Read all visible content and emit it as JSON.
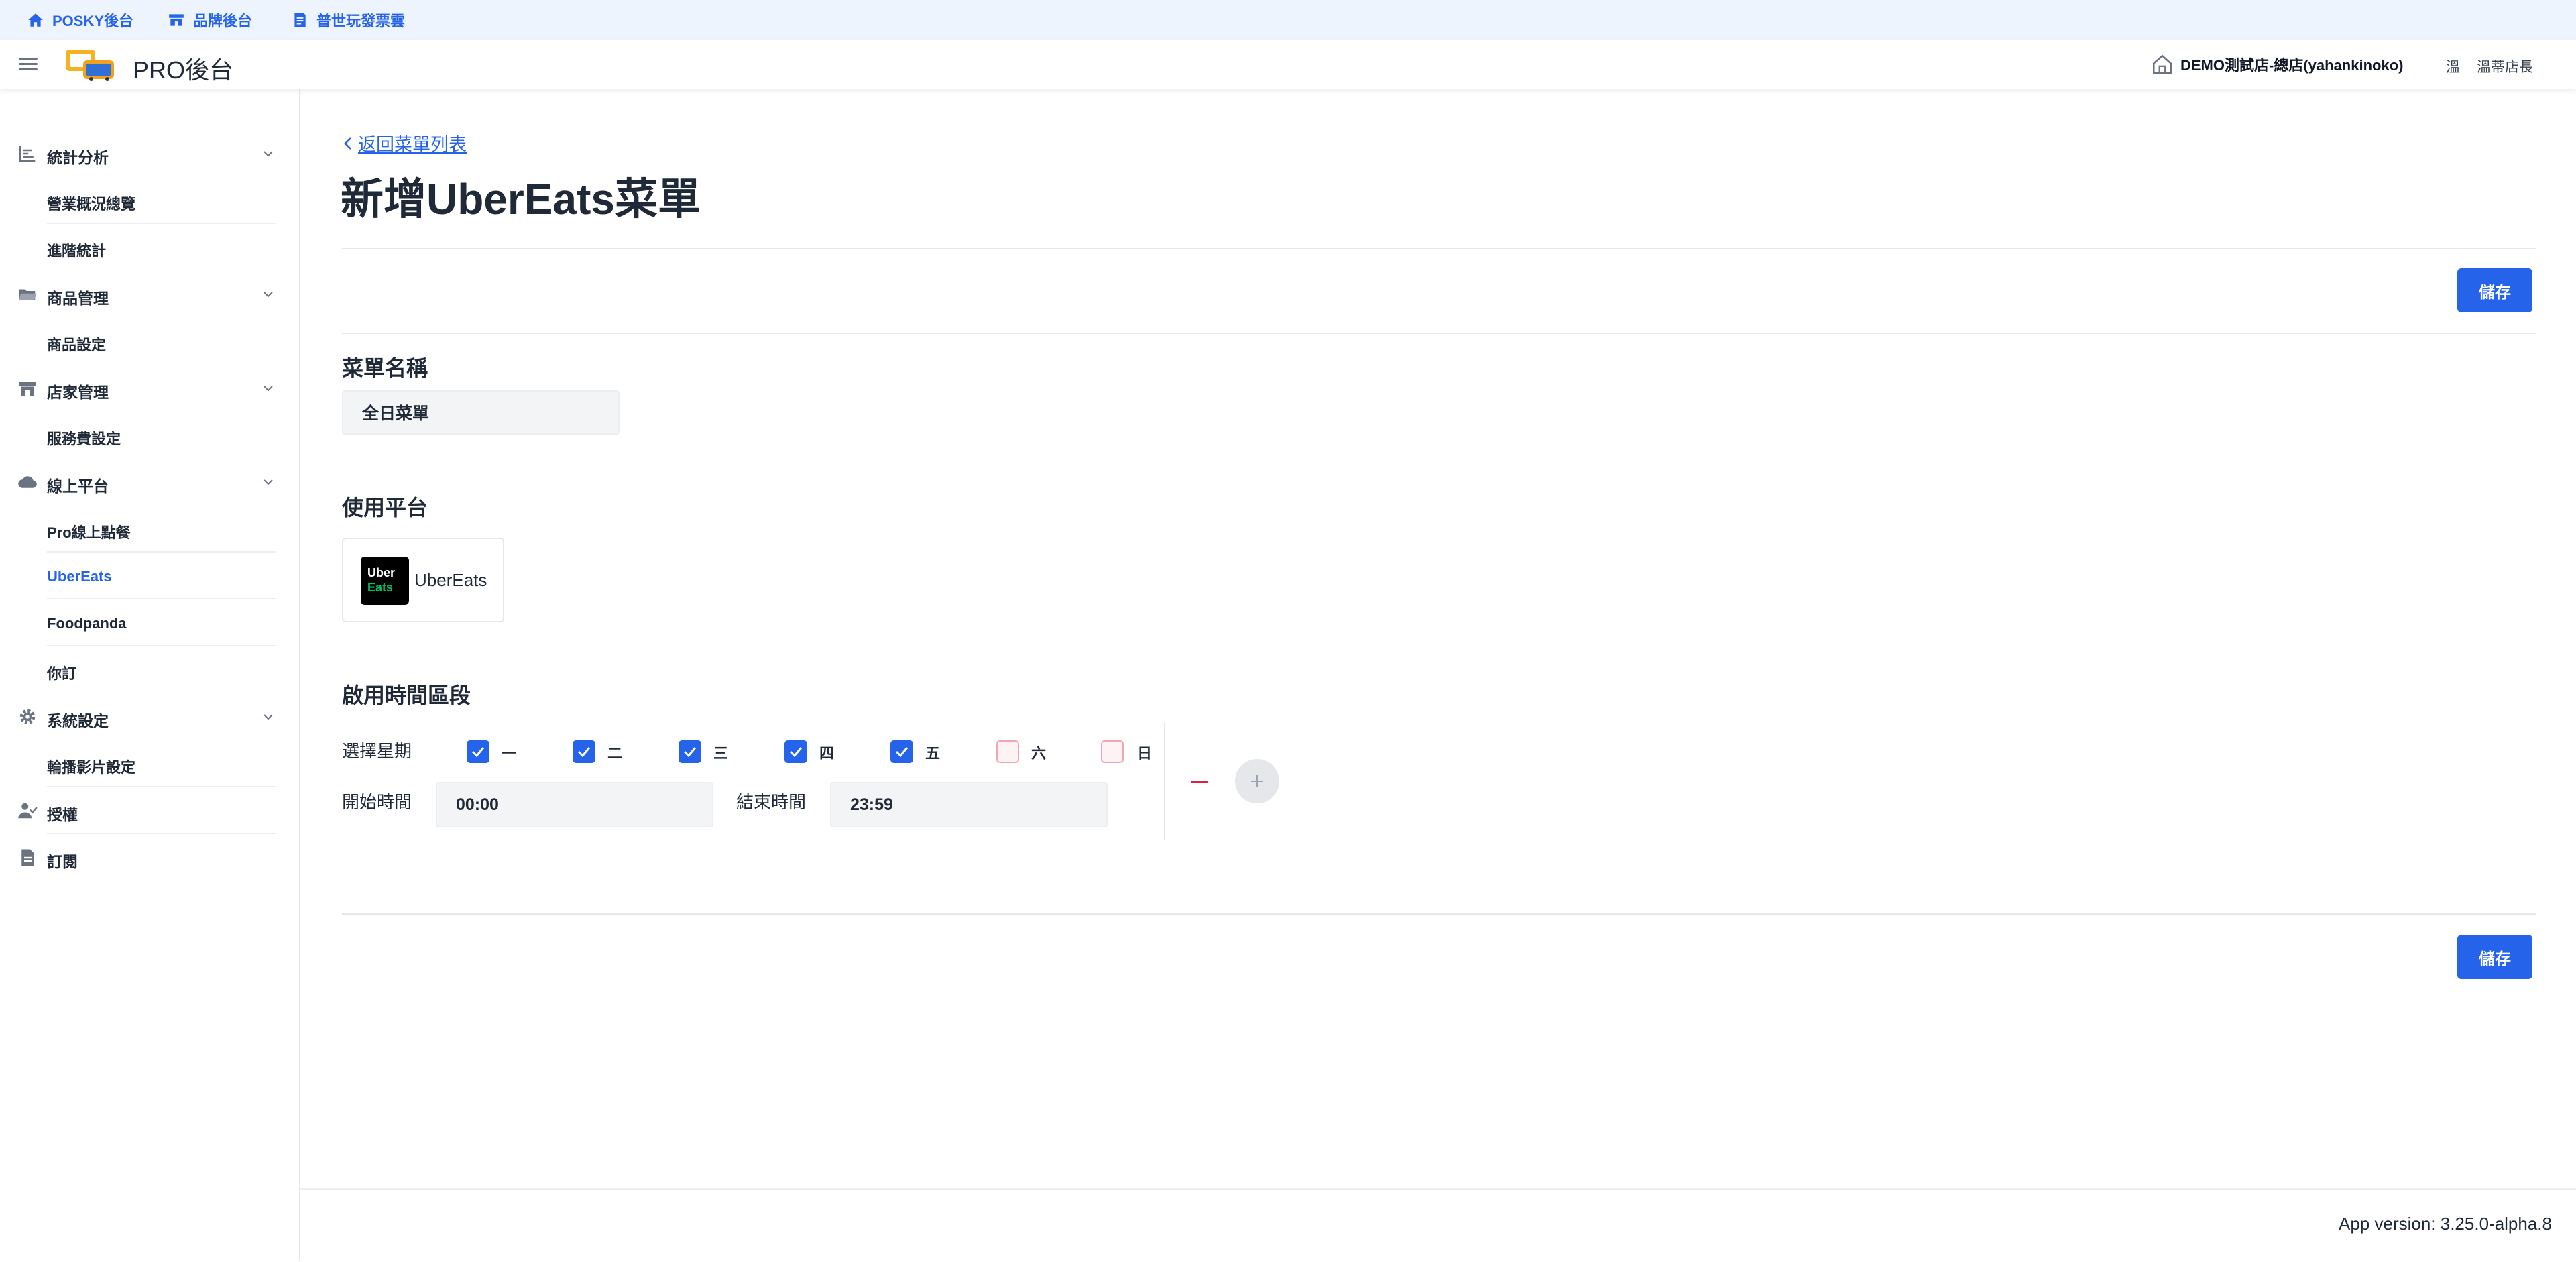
{
  "top_links": [
    {
      "label": "POSKY後台",
      "icon": "home-icon"
    },
    {
      "label": "品牌後台",
      "icon": "brand-store-icon"
    },
    {
      "label": "普世玩發票雲",
      "icon": "invoice-doc-icon"
    }
  ],
  "header": {
    "app_title": "PRO後台",
    "store_name": "DEMO測試店-總店(yahankinoko)",
    "store_icon": "house-icon",
    "user_short": "溫",
    "user_name": "溫蒂店長"
  },
  "sidebar": {
    "groups": [
      {
        "label": "統計分析",
        "icon": "chart-icon",
        "expandable": true,
        "items": [
          "營業概況總覽",
          "進階統計"
        ]
      },
      {
        "label": "商品管理",
        "icon": "folder-icon",
        "expandable": true,
        "items": [
          "商品設定"
        ]
      },
      {
        "label": "店家管理",
        "icon": "storefront-icon",
        "expandable": true,
        "items": [
          "服務費設定"
        ]
      },
      {
        "label": "線上平台",
        "icon": "cloud-icon",
        "expandable": true,
        "items": [
          "Pro線上點餐",
          "UberEats",
          "Foodpanda",
          "你訂"
        ]
      },
      {
        "label": "系統設定",
        "icon": "gear-icon",
        "expandable": true,
        "items": [
          "輪播影片設定"
        ]
      },
      {
        "label": "授權",
        "icon": "user-check-icon",
        "expandable": false,
        "items": []
      },
      {
        "label": "訂閱",
        "icon": "document-icon",
        "expandable": false,
        "items": []
      }
    ],
    "active_item": "UberEats"
  },
  "main": {
    "back_link": "返回菜單列表",
    "title": "新增UberEats菜單",
    "save_label": "儲存",
    "menu_name_label": "菜單名稱",
    "menu_name_value": "全日菜單",
    "platform_label": "使用平台",
    "platform": {
      "name": "UberEats",
      "logo_line1": "Uber",
      "logo_line2": "Eats"
    },
    "time_section_label": "啟用時間區段",
    "weekday_label": "選擇星期",
    "weekdays": [
      {
        "label": "一",
        "checked": true
      },
      {
        "label": "二",
        "checked": true
      },
      {
        "label": "三",
        "checked": true
      },
      {
        "label": "四",
        "checked": true
      },
      {
        "label": "五",
        "checked": true
      },
      {
        "label": "六",
        "checked": false
      },
      {
        "label": "日",
        "checked": false
      }
    ],
    "start_label": "開始時間",
    "start_value": "00:00",
    "end_label": "結束時間",
    "end_value": "23:59"
  },
  "footer": {
    "version": "App version: 3.25.0-alpha.8"
  },
  "colors": {
    "accent": "#2563eb",
    "danger": "#e11d48",
    "topbar_bg": "#eef4fe"
  }
}
